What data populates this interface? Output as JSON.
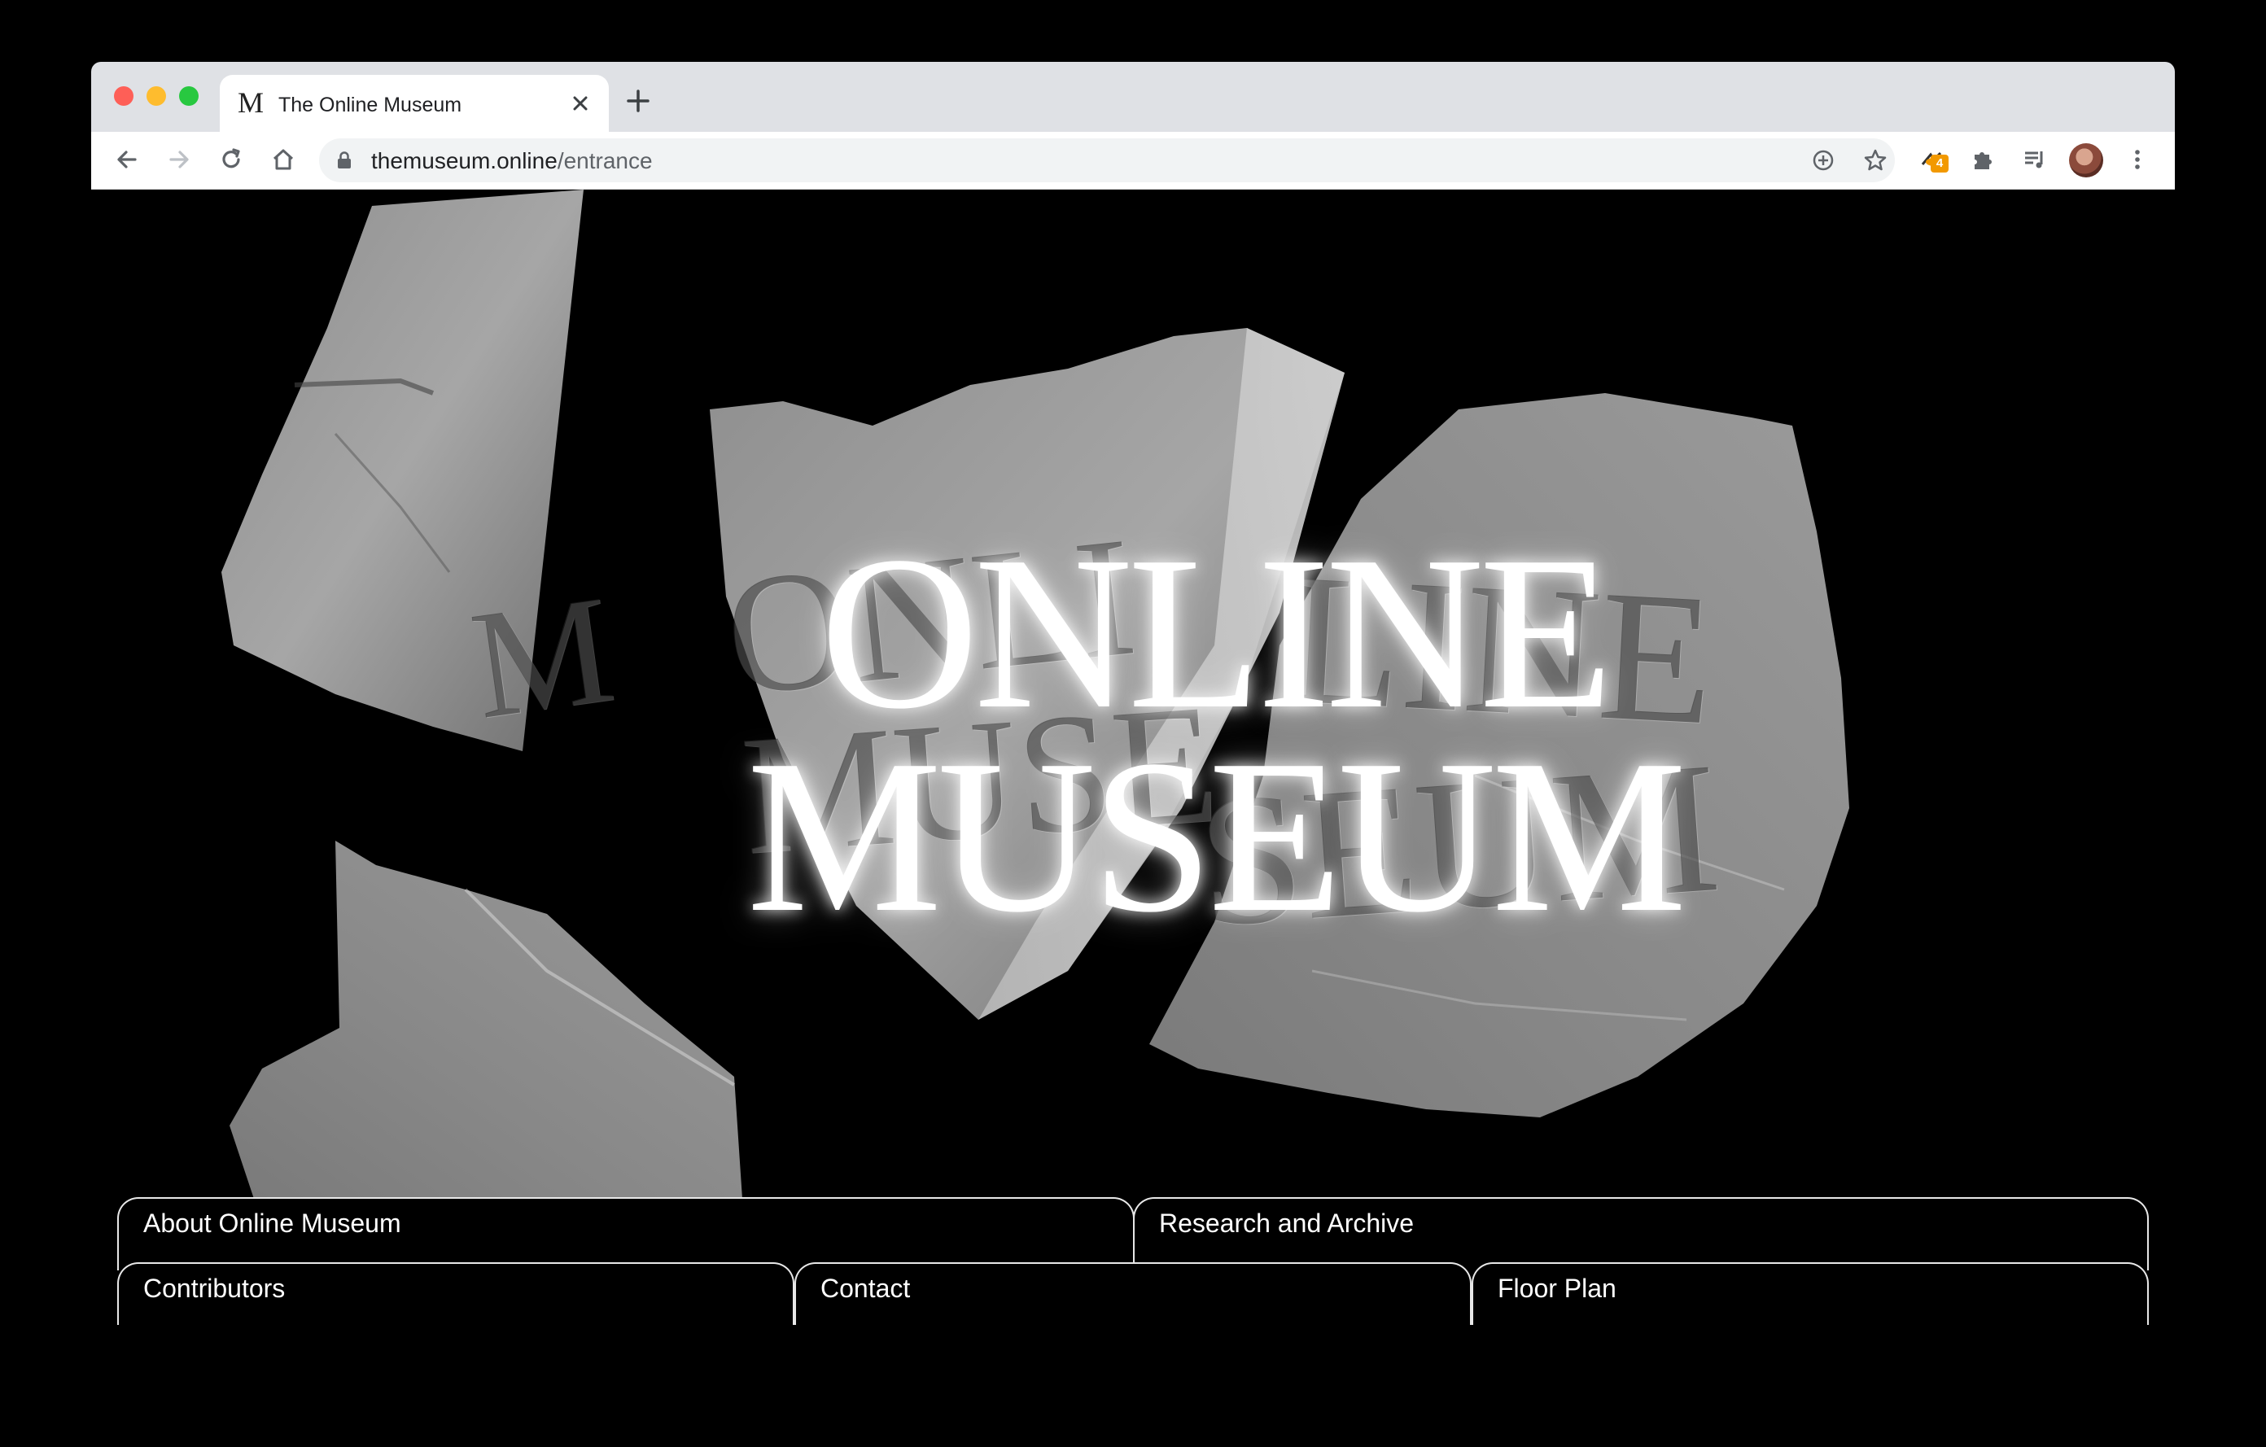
{
  "browser": {
    "tab": {
      "favicon": "M",
      "title": "The Online Museum"
    },
    "address_bar": {
      "domain": "themuseum.online",
      "path": "/entrance"
    },
    "extension_badge": "4",
    "icons": [
      "back-icon",
      "forward-icon",
      "reload-icon",
      "home-icon",
      "lock-icon",
      "install-icon",
      "star-icon",
      "extension-icon",
      "puzzle-icon",
      "media-icon",
      "profile-avatar",
      "menu-icon"
    ]
  },
  "hero": {
    "title_line1": "ONLINE",
    "title_line2": "MUSEUM",
    "engraved_left": "ONLI",
    "engraved_left2": "MUSE",
    "engraved_right": "LINE",
    "engraved_right2": "SEUM",
    "engraved_small": "M"
  },
  "nav": {
    "about": "About Online Museum",
    "research": "Research and Archive",
    "contributors": "Contributors",
    "contact": "Contact",
    "floor_plan": "Floor Plan"
  }
}
